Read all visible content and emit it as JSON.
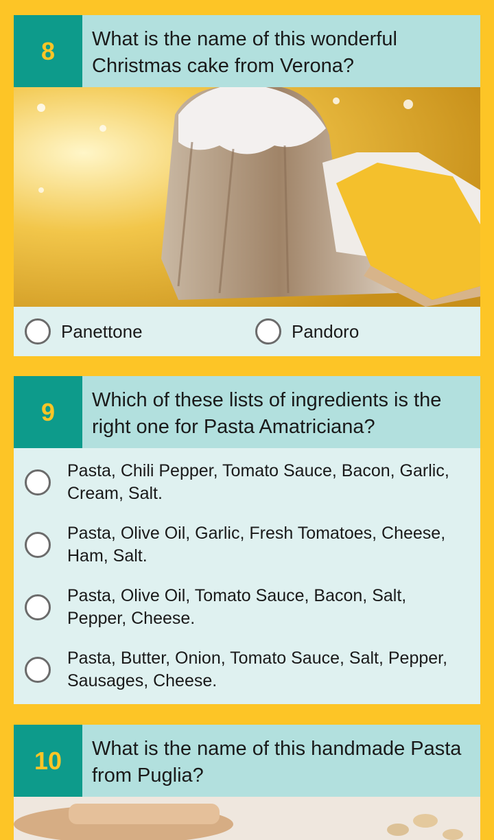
{
  "questions": [
    {
      "number": "8",
      "text": "What is the name of this wonderful Christmas cake from Verona?",
      "answers": [
        "Panettone",
        "Pandoro"
      ]
    },
    {
      "number": "9",
      "text": "Which of these lists of ingredients is the right one for Pasta Amatriciana?",
      "answers": [
        "Pasta, Chili Pepper, Tomato Sauce, Bacon, Garlic, Cream, Salt.",
        "Pasta, Olive Oil, Garlic, Fresh Tomatoes, Cheese, Ham, Salt.",
        "Pasta, Olive Oil, Tomato Sauce, Bacon, Salt, Pepper, Cheese.",
        "Pasta, Butter, Onion, Tomato Sauce, Salt, Pepper, Sausages, Cheese."
      ]
    },
    {
      "number": "10",
      "text": "What is the name of this handmade Pasta from Puglia?"
    }
  ],
  "colors": {
    "background": "#fdc526",
    "number_badge": "#0d9b8b",
    "question_bar": "#b2e0de",
    "answer_panel": "#dff1f0"
  }
}
